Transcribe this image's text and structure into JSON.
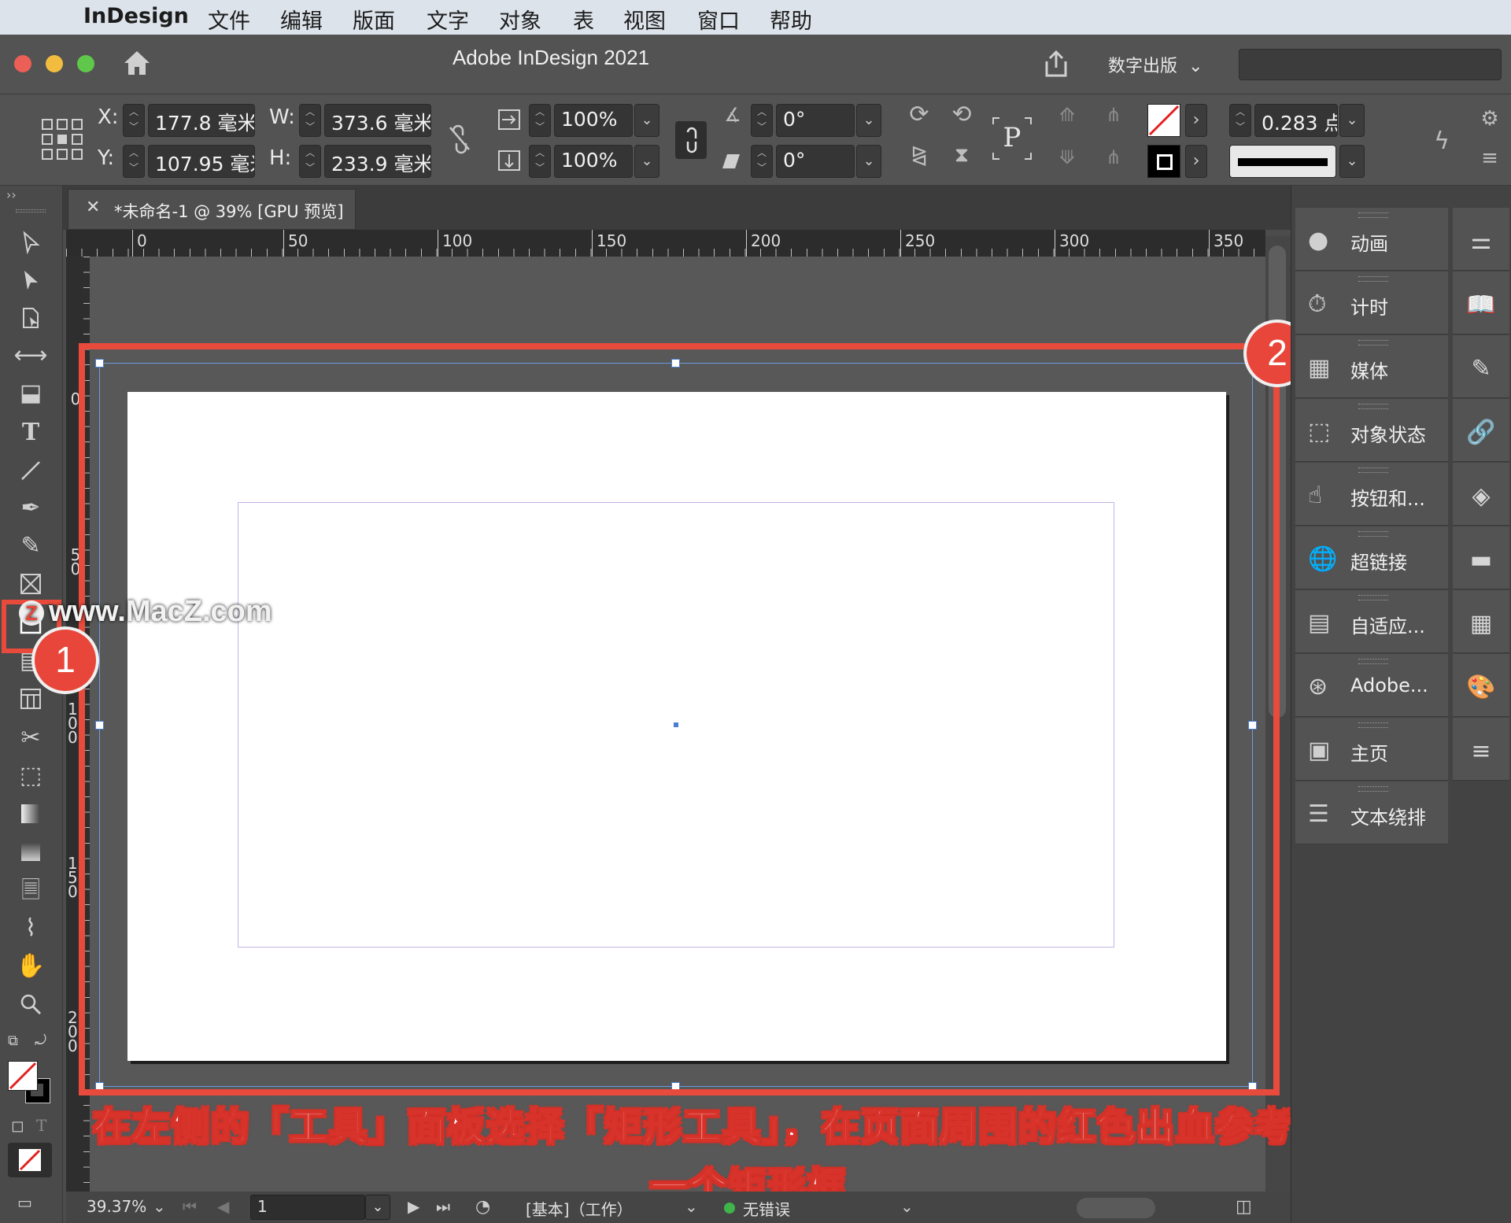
{
  "menubar": {
    "app": "InDesign",
    "items": [
      "文件",
      "编辑",
      "版面",
      "文字",
      "对象",
      "表",
      "视图",
      "窗口",
      "帮助"
    ]
  },
  "window": {
    "title": "Adobe InDesign 2021",
    "workspace": "数字出版"
  },
  "control": {
    "x_label": "X:",
    "x_value": "177.8 毫米",
    "y_label": "Y:",
    "y_value": "107.95 毫米",
    "w_label": "W:",
    "w_value": "373.6 毫米",
    "h_label": "H:",
    "h_value": "233.9 毫米",
    "scale_x": "100%",
    "scale_y": "100%",
    "rotate": "0°",
    "shear": "0°",
    "stroke_weight": "0.283 点"
  },
  "document": {
    "tab_name": "*未命名-1 @ 39% [GPU 预览]",
    "close": "✕"
  },
  "ruler": {
    "top": [
      "0",
      "50",
      "100",
      "150",
      "200",
      "250",
      "300",
      "350"
    ],
    "left": [
      "0",
      "50",
      "100",
      "150",
      "200"
    ]
  },
  "statusbar": {
    "zoom": "39.37%",
    "page": "1",
    "style": "[基本]（工作）",
    "preflight": "无错误"
  },
  "panels": [
    {
      "label": "动画",
      "icon": "animation-icon"
    },
    {
      "label": "计时",
      "icon": "timing-icon"
    },
    {
      "label": "媒体",
      "icon": "media-icon"
    },
    {
      "label": "对象状态",
      "icon": "object-states-icon"
    },
    {
      "label": "按钮和...",
      "icon": "buttons-icon"
    },
    {
      "label": "超链接",
      "icon": "hyperlinks-icon"
    },
    {
      "label": "自适应...",
      "icon": "liquid-layout-icon"
    },
    {
      "label": "Adobe...",
      "icon": "adobe-color-icon"
    },
    {
      "label": "主页",
      "icon": "pages-icon"
    },
    {
      "label": "文本绕排",
      "icon": "text-wrap-icon"
    }
  ],
  "annotations": {
    "badge1": "1",
    "badge2": "2",
    "watermark": "www.MacZ.com",
    "watermark_logo": "Z",
    "caption_line1": "在左侧的「工具」面板选择「矩形工具」，在页面周围的红色出血参考线处绘制",
    "caption_line2": "一个矩形框"
  },
  "colors": {
    "accent_red": "#e84a3c",
    "selection_blue": "#4a7fd0",
    "margin_purple": "#c3b3e6"
  }
}
